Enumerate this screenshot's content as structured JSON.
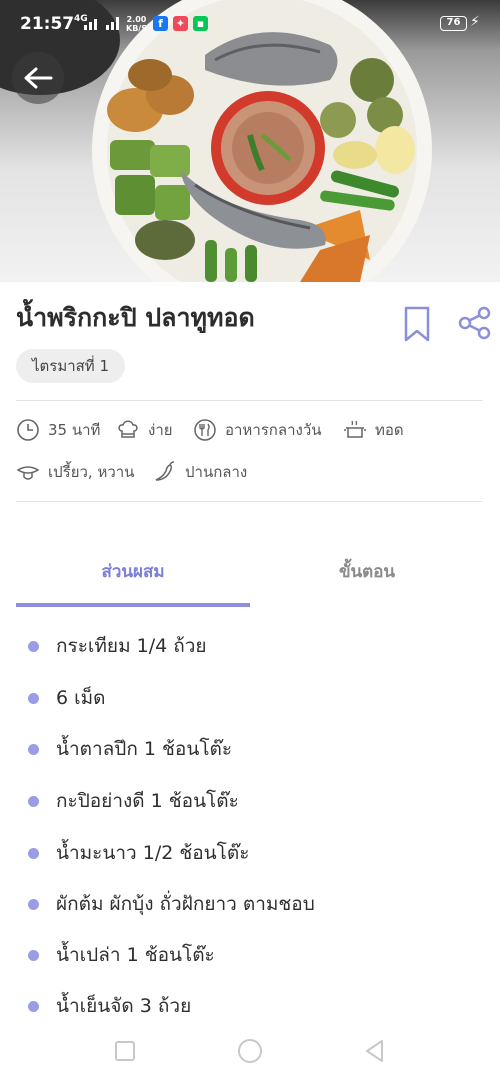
{
  "status_bar": {
    "time": "21:57",
    "network": "4G",
    "speed_value": "2.00",
    "speed_unit": "KB/S",
    "battery": "76"
  },
  "recipe": {
    "title": "น้ำพริกกะปิ ปลาทูทอด",
    "tag": "ไตรมาสที่ 1",
    "meta": {
      "time": "35 นาที",
      "difficulty": "ง่าย",
      "meal": "อาหารกลางวัน",
      "method": "ทอด",
      "taste": "เปรี้ยว, หวาน",
      "spice": "ปานกลาง"
    }
  },
  "tabs": {
    "ingredients": "ส่วนผสม",
    "steps": "ขั้นตอน"
  },
  "ingredients": [
    "กระเทียม 1/4 ถ้วย",
    "6 เม็ด",
    "น้ำตาลปึก 1 ช้อนโต๊ะ",
    "กะปิอย่างดี 1 ช้อนโต๊ะ",
    "น้ำมะนาว 1/2 ช้อนโต๊ะ",
    "ผักต้ม ผักบุ้ง ถั่วฝักยาว ตามชอบ",
    "น้ำเปล่า 1 ช้อนโต๊ะ",
    "น้ำเย็นจัด 3 ถ้วย"
  ],
  "colors": {
    "accent": "#7b7fd6",
    "bullet": "#9a9de3",
    "chip_bg": "#eeeeee"
  }
}
